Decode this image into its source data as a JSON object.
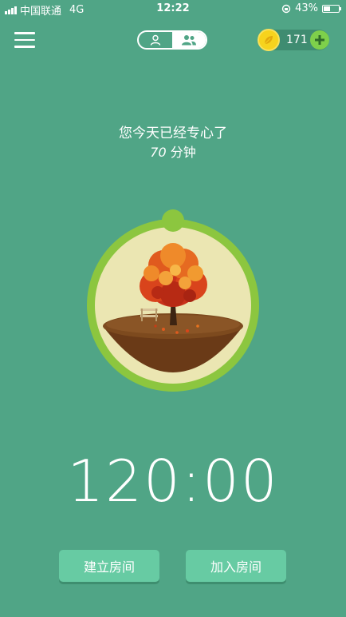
{
  "status_bar": {
    "carrier": "中国联通",
    "network": "4G",
    "time": "12:22",
    "battery_percent": "43%",
    "battery_level": 0.43
  },
  "header": {
    "coin_count": "171",
    "active_mode": "group"
  },
  "focus_summary": {
    "line1": "您今天已经专心了",
    "minutes": "70",
    "unit": "分钟"
  },
  "tree": {
    "progress": 0
  },
  "timer": {
    "display": "120:00"
  },
  "actions": {
    "create_room": "建立房间",
    "join_room": "加入房间"
  },
  "colors": {
    "background": "#50a586",
    "ring": "#8cc63f",
    "coin": "#f6d31d",
    "button": "#67cba3"
  }
}
